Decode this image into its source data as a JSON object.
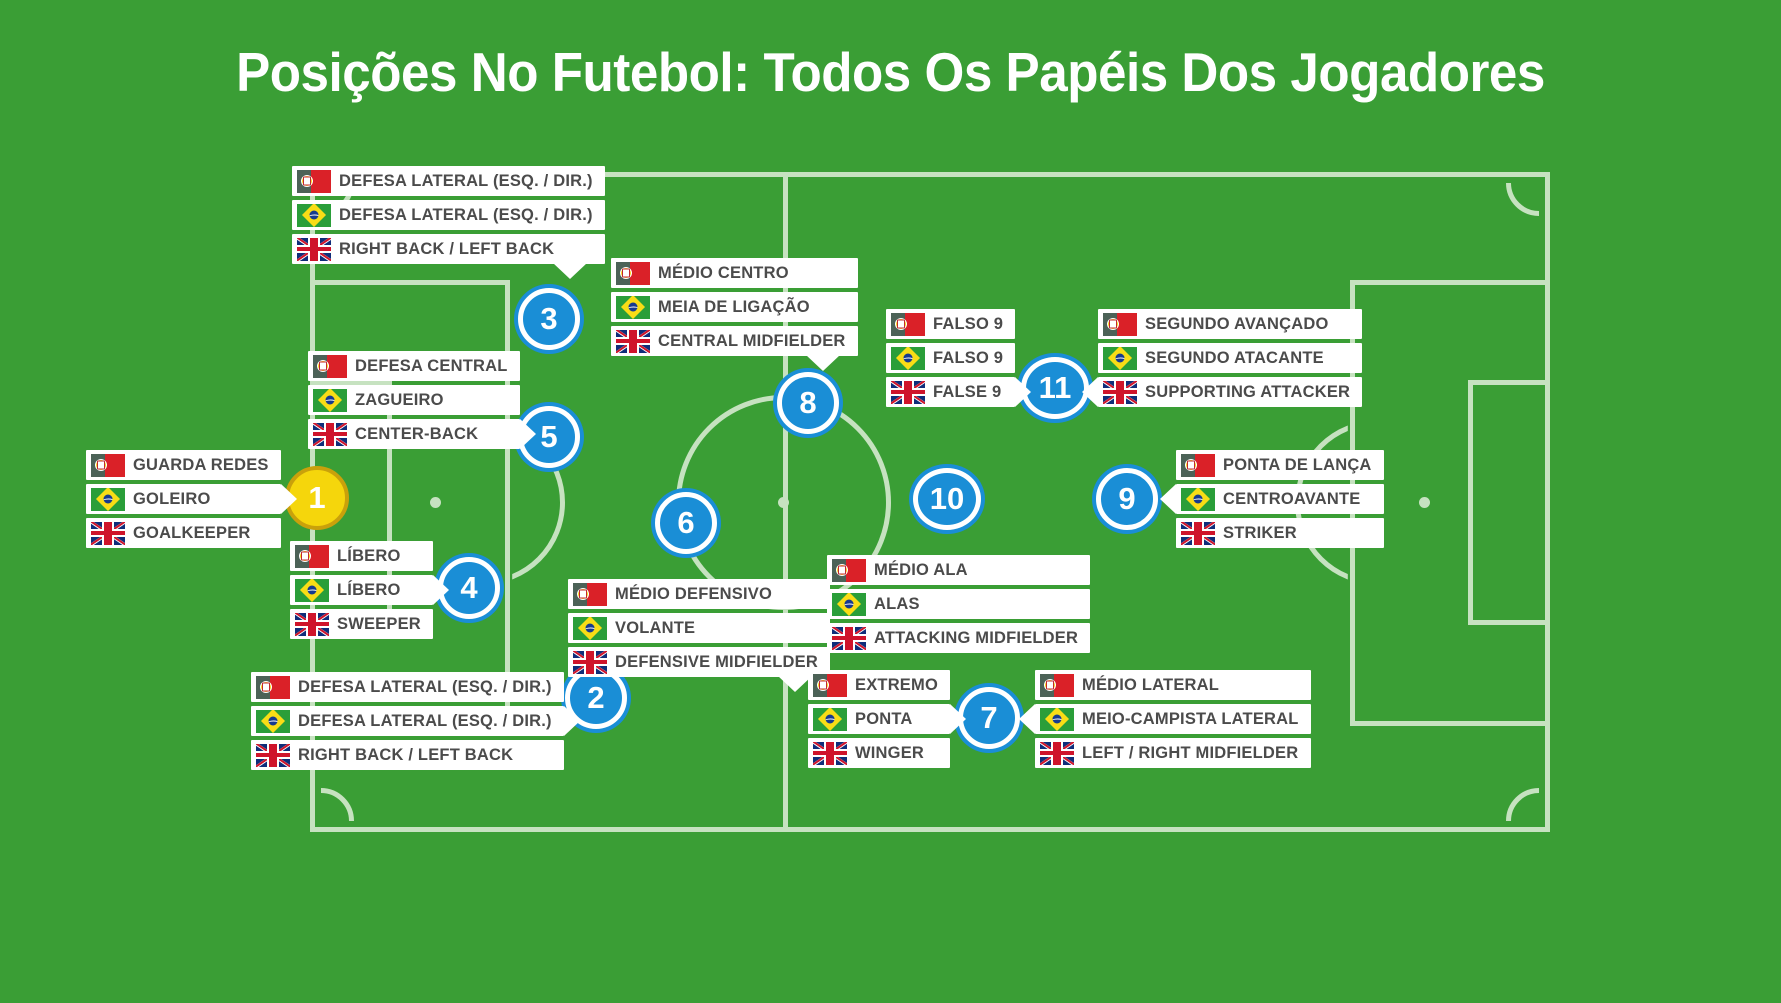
{
  "header": {
    "title": "Posições No Futebol: Todos Os Papéis Dos Jogadores"
  },
  "colors": {
    "pitch_green": "#3a9e35",
    "pitch_lines": "#c6e2c0",
    "circle_blue": "#1a8ed6",
    "goalkeeper_yellow": "#f5d60c",
    "label_bg": "#ffffff",
    "label_text": "#4b4b4b",
    "title_text": "#ffffff"
  },
  "legend": {
    "flags": [
      "portugal-flag",
      "brazil-flag",
      "uk-flag"
    ],
    "languages": [
      "Português (PT)",
      "Português (BR)",
      "English"
    ]
  },
  "positions": [
    {
      "number": "1",
      "kind": "goalkeeper",
      "labels": [
        {
          "flag": "portugal-flag",
          "text": "GUARDA REDES"
        },
        {
          "flag": "brazil-flag",
          "text": "GOLEIRO"
        },
        {
          "flag": "uk-flag",
          "text": "GOALKEEPER"
        }
      ]
    },
    {
      "number": "2",
      "kind": "outfield",
      "labels": [
        {
          "flag": "portugal-flag",
          "text": "DEFESA LATERAL (ESQ. / DIR.)"
        },
        {
          "flag": "brazil-flag",
          "text": "DEFESA LATERAL (ESQ. / DIR.)"
        },
        {
          "flag": "uk-flag",
          "text": "RIGHT BACK / LEFT BACK"
        }
      ]
    },
    {
      "number": "3",
      "kind": "outfield",
      "labels": [
        {
          "flag": "portugal-flag",
          "text": "DEFESA LATERAL (ESQ. / DIR.)"
        },
        {
          "flag": "brazil-flag",
          "text": "DEFESA LATERAL (ESQ. / DIR.)"
        },
        {
          "flag": "uk-flag",
          "text": "RIGHT BACK / LEFT BACK"
        }
      ]
    },
    {
      "number": "4",
      "kind": "outfield",
      "labels": [
        {
          "flag": "portugal-flag",
          "text": "LÍBERO"
        },
        {
          "flag": "brazil-flag",
          "text": "LÍBERO"
        },
        {
          "flag": "uk-flag",
          "text": "SWEEPER"
        }
      ]
    },
    {
      "number": "5",
      "kind": "outfield",
      "labels": [
        {
          "flag": "portugal-flag",
          "text": "DEFESA CENTRAL"
        },
        {
          "flag": "brazil-flag",
          "text": "ZAGUEIRO"
        },
        {
          "flag": "uk-flag",
          "text": "CENTER-BACK"
        }
      ]
    },
    {
      "number": "6",
      "kind": "outfield",
      "labels": [
        {
          "flag": "portugal-flag",
          "text": "MÉDIO DEFENSIVO"
        },
        {
          "flag": "brazil-flag",
          "text": "VOLANTE"
        },
        {
          "flag": "uk-flag",
          "text": "DEFENSIVE MIDFIELDER"
        }
      ]
    },
    {
      "number": "7",
      "kind": "outfield",
      "labels": [
        {
          "flag": "portugal-flag",
          "text": "EXTREMO"
        },
        {
          "flag": "brazil-flag",
          "text": "PONTA"
        },
        {
          "flag": "uk-flag",
          "text": "WINGER"
        }
      ]
    },
    {
      "number": "8",
      "kind": "outfield",
      "labels": [
        {
          "flag": "portugal-flag",
          "text": "MÉDIO CENTRO"
        },
        {
          "flag": "brazil-flag",
          "text": "MEIA DE LIGAÇÃO"
        },
        {
          "flag": "uk-flag",
          "text": "CENTRAL MIDFIELDER"
        }
      ]
    },
    {
      "number": "9",
      "kind": "outfield",
      "labels": [
        {
          "flag": "portugal-flag",
          "text": "PONTA DE LANÇA"
        },
        {
          "flag": "brazil-flag",
          "text": "CENTROAVANTE"
        },
        {
          "flag": "uk-flag",
          "text": "STRIKER"
        }
      ]
    },
    {
      "number": "10",
      "kind": "outfield",
      "labels": [
        {
          "flag": "portugal-flag",
          "text": "MÉDIO ALA"
        },
        {
          "flag": "brazil-flag",
          "text": "ALAS"
        },
        {
          "flag": "uk-flag",
          "text": "ATTACKING MIDFIELDER"
        }
      ]
    },
    {
      "number": "11",
      "kind": "outfield",
      "labels": [
        {
          "flag": "portugal-flag",
          "text": "FALSO 9"
        },
        {
          "flag": "brazil-flag",
          "text": "FALSO 9"
        },
        {
          "flag": "uk-flag",
          "text": "FALSE 9"
        }
      ]
    },
    {
      "number": "11b",
      "kind": "outfield-extra",
      "labels": [
        {
          "flag": "portugal-flag",
          "text": "SEGUNDO AVANÇADO"
        },
        {
          "flag": "brazil-flag",
          "text": "SEGUNDO ATACANTE"
        },
        {
          "flag": "uk-flag",
          "text": "SUPPORTING ATTACKER"
        }
      ]
    },
    {
      "number": "7b",
      "kind": "outfield-extra",
      "labels": [
        {
          "flag": "portugal-flag",
          "text": "MÉDIO LATERAL"
        },
        {
          "flag": "brazil-flag",
          "text": "MEIO-CAMPISTA LATERAL"
        },
        {
          "flag": "uk-flag",
          "text": "LEFT / RIGHT MIDFIELDER"
        }
      ]
    }
  ],
  "circle_numbers": {
    "one": "1",
    "two": "2",
    "three": "3",
    "four": "4",
    "five": "5",
    "six": "6",
    "seven": "7",
    "eight": "8",
    "nine": "9",
    "ten": "10",
    "eleven": "11"
  }
}
